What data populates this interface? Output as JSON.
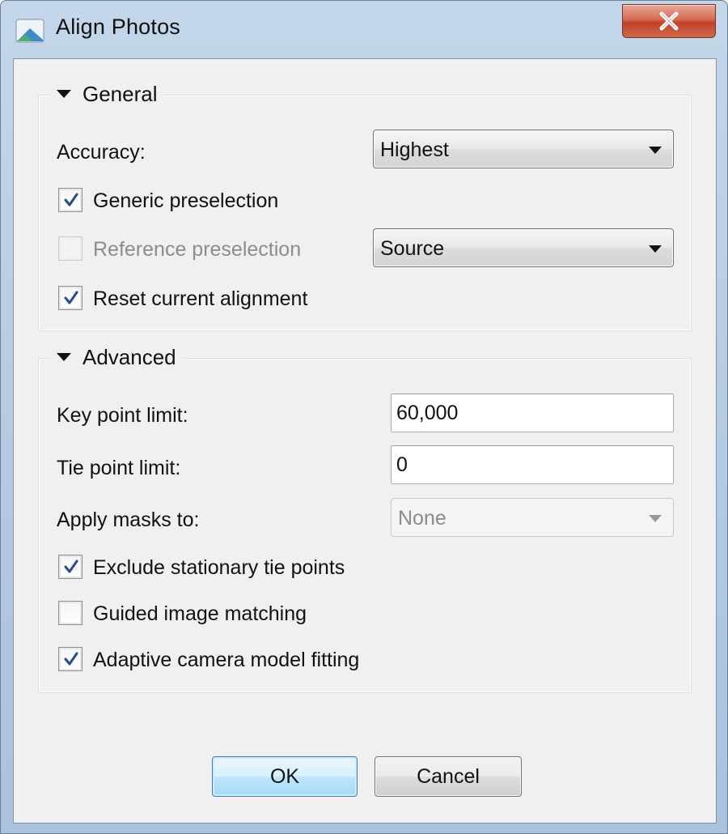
{
  "window": {
    "title": "Align Photos"
  },
  "general": {
    "title": "General",
    "accuracy_label": "Accuracy:",
    "accuracy_value": "Highest",
    "generic_preselection_label": "Generic preselection",
    "generic_preselection_checked": true,
    "reference_preselection_label": "Reference preselection",
    "reference_preselection_checked": false,
    "reference_preselection_enabled": false,
    "reference_source_value": "Source",
    "reset_alignment_label": "Reset current alignment",
    "reset_alignment_checked": true
  },
  "advanced": {
    "title": "Advanced",
    "key_point_limit_label": "Key point limit:",
    "key_point_limit_value": "60,000",
    "tie_point_limit_label": "Tie point limit:",
    "tie_point_limit_value": "0",
    "apply_masks_label": "Apply masks to:",
    "apply_masks_value": "None",
    "exclude_stationary_label": "Exclude stationary tie points",
    "exclude_stationary_checked": true,
    "guided_matching_label": "Guided image matching",
    "guided_matching_checked": false,
    "adaptive_fitting_label": "Adaptive camera model fitting",
    "adaptive_fitting_checked": true
  },
  "buttons": {
    "ok": "OK",
    "cancel": "Cancel"
  },
  "icons": {
    "app": "photoscan-app-icon",
    "close": "close-icon",
    "expand": "triangle-down-icon",
    "dropdown": "chevron-down-icon",
    "check": "checkmark-icon"
  },
  "colors": {
    "titlebar": "#b9cde4",
    "close_button": "#c94b33",
    "check_mark": "#2b4a8a",
    "default_button_border": "#3c7fb1"
  }
}
